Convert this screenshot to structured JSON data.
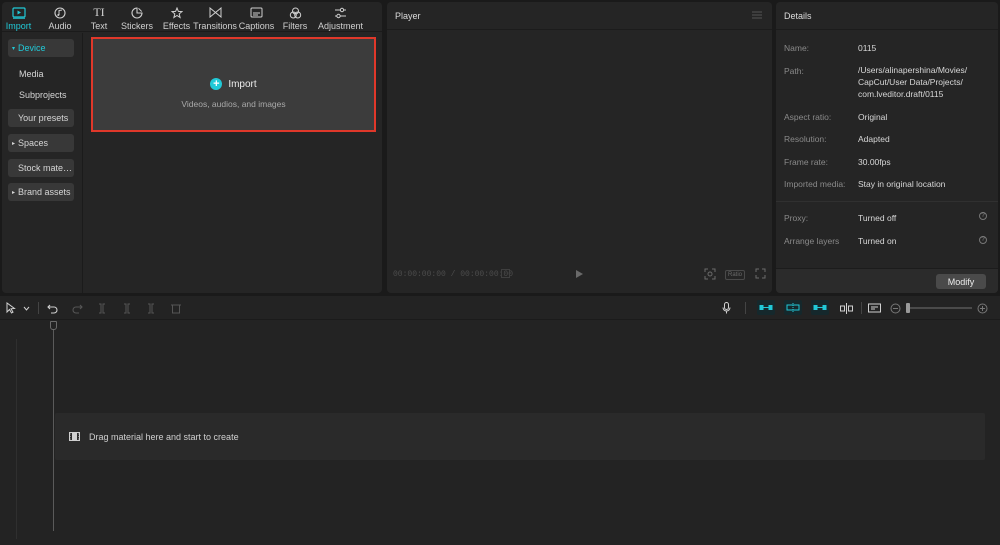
{
  "tabs": [
    {
      "key": "import",
      "label": "Import",
      "icon": "import-icon",
      "active": true
    },
    {
      "key": "audio",
      "label": "Audio",
      "icon": "audio-icon",
      "active": false
    },
    {
      "key": "text",
      "label": "Text",
      "icon": "text-icon",
      "active": false
    },
    {
      "key": "stickers",
      "label": "Stickers",
      "icon": "stickers-icon",
      "active": false
    },
    {
      "key": "effects",
      "label": "Effects",
      "icon": "effects-icon",
      "active": false
    },
    {
      "key": "transitions",
      "label": "Transitions",
      "icon": "transitions-icon",
      "active": false
    },
    {
      "key": "captions",
      "label": "Captions",
      "icon": "captions-icon",
      "active": false
    },
    {
      "key": "filters",
      "label": "Filters",
      "icon": "filters-icon",
      "active": false
    },
    {
      "key": "adjustment",
      "label": "Adjustment",
      "icon": "adjustment-icon",
      "active": false
    }
  ],
  "sidebar": {
    "device": "Device",
    "media": "Media",
    "subprojects": "Subprojects",
    "your_presets": "Your presets",
    "spaces": "Spaces",
    "stock": "Stock mate…",
    "brand_assets": "Brand assets"
  },
  "import_box": {
    "button": "Import",
    "subtitle": "Videos, audios, and images"
  },
  "player": {
    "title": "Player",
    "timecode": "00:00:00:00 / 00:00:00:00",
    "ratio_label": "Ratio"
  },
  "details": {
    "title": "Details",
    "rows": {
      "name": {
        "label": "Name:",
        "value": "0115"
      },
      "path": {
        "label": "Path:",
        "line1": "/Users/alinapershina/Movies/",
        "line2": "CapCut/User Data/Projects/",
        "line3": "com.lveditor.draft/0115"
      },
      "aspect": {
        "label": "Aspect ratio:",
        "value": "Original"
      },
      "resolution": {
        "label": "Resolution:",
        "value": "Adapted"
      },
      "framerate": {
        "label": "Frame rate:",
        "value": "30.00fps"
      },
      "imported": {
        "label": "Imported media:",
        "value": "Stay in original location"
      },
      "proxy": {
        "label": "Proxy:",
        "value": "Turned off"
      },
      "layers": {
        "label": "Arrange layers",
        "value": "Turned on"
      }
    },
    "modify": "Modify"
  },
  "timeline": {
    "drop_hint": "Drag material here and start to create"
  },
  "colors": {
    "accent": "#21c9d7",
    "highlight_border": "#e0382a",
    "background": "#1a1a1a",
    "panel": "#252525"
  }
}
